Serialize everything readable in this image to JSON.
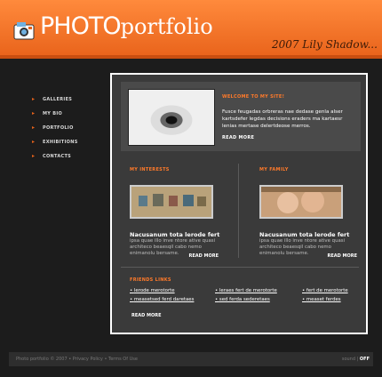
{
  "header": {
    "logo_photo": "PHOTO",
    "logo_portfolio": "portfolio",
    "signature": "2007 Lily Shadow..."
  },
  "nav": {
    "items": [
      {
        "label": "GALLERIES"
      },
      {
        "label": "MY BIO"
      },
      {
        "label": "PORTFOLIO"
      },
      {
        "label": "EXHIBITIONS"
      },
      {
        "label": "CONTACTS"
      }
    ]
  },
  "hero": {
    "title": "WELCOME TO MY SITE!",
    "body": "Fusce feugadas orbreras nae dedase genla alser kartsdefer legdas decisions eraders ma kartaesr lenias mertase delertdeose merros.",
    "more": "READ MORE"
  },
  "interests": {
    "title": "MY INTERESTS",
    "headline": "Nacusanum tota lerode fert",
    "body": "ipsa quae illo inve ntore ative quasi architeco beaesqil cabo nemo enimanolu bersame.",
    "more": "READ MORE"
  },
  "family": {
    "title": "MY FAMILY",
    "headline": "Nacusanum tota lerode fert",
    "body": "ipsa quae illo inve ntore ative quasi architeco beaesqil cabo nemo enimanolu bersame.",
    "more": "READ MORE"
  },
  "friends": {
    "title": "FRIENDS LINKS",
    "links": [
      "lerode merotorte",
      "measetsed ferd daretaes",
      "leraes fert de merotorte",
      "sed ferda sederetaes",
      "fert de merotorte",
      "measet ferdes"
    ],
    "more": "READ MORE"
  },
  "footer": {
    "text": "Photo portfolio © 2007 • Privacy Policy • Terms Of Use",
    "sound_label": "sound",
    "sound_state": "OFF"
  },
  "colors": {
    "accent": "#e8621a",
    "header_top": "#ff8a3c",
    "background": "#1c1c1c",
    "panel": "#3a3a3a"
  },
  "icons": {
    "logo": "camera-icon",
    "nav_bullet": "arrow-right-icon"
  }
}
